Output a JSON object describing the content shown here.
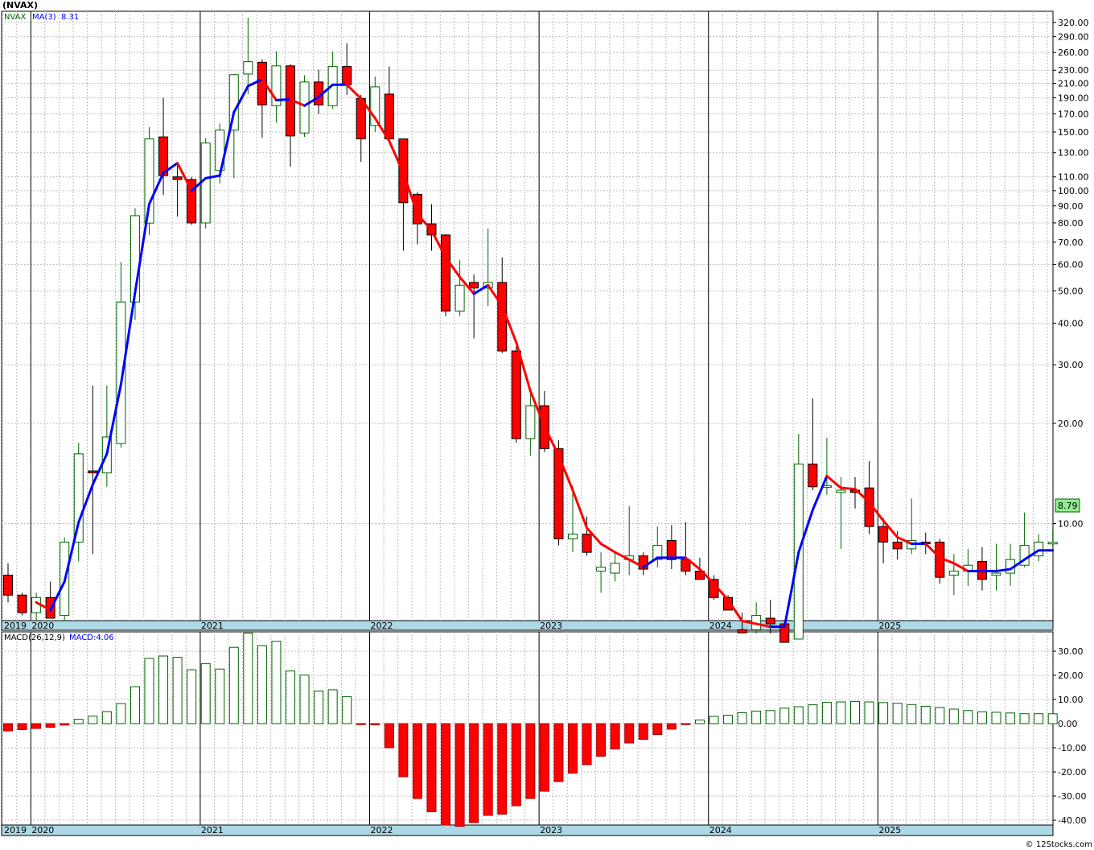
{
  "title": "(NVAX)",
  "legend": {
    "symbol": "NVAX",
    "ma_label": "MA(3)",
    "ma_value": "8.31"
  },
  "macd_legend": {
    "label": "MACD(26,12,9)",
    "value_label": "MACD:4.06"
  },
  "last_price_label": "8.79",
  "watermark": "© 12Stocks.com",
  "colors": {
    "up": "#ffffff",
    "up_stroke": "#006400",
    "down": "#ff0000",
    "down_stroke": "#000000",
    "ma_up": "#0000ff",
    "ma_down": "#ff0000",
    "grid": "#bdbdbd",
    "axis_bar": "#add8e6",
    "price_box": "#90ee90"
  },
  "chart_data": [
    {
      "type": "candlestick",
      "title": "(NVAX)",
      "scale": "log",
      "ylim": [
        5.2,
        340
      ],
      "y_ticks": [
        10,
        20,
        30,
        40,
        50,
        60,
        70,
        80,
        90,
        100,
        110,
        130,
        150,
        170,
        190,
        210,
        230,
        260,
        290,
        320
      ],
      "y_tick_labels": [
        "10.00",
        "20.00",
        "30.00",
        "40.00",
        "50.00",
        "60.00",
        "70.00",
        "80.00",
        "90.00",
        "100.00",
        "110.00",
        "130.00",
        "150.00",
        "170.00",
        "190.00",
        "210.00",
        "230.00",
        "260.00",
        "290.00",
        "320.00"
      ],
      "x_labels": [
        "2019",
        "2020",
        "2021",
        "2022",
        "2023",
        "2024",
        "2025"
      ],
      "x_label_months": [
        0,
        2,
        14,
        26,
        38,
        50,
        62
      ],
      "series_name": "NVAX",
      "start": "2019-11",
      "ohlc": [
        [
          7.0,
          7.6,
          5.8,
          6.1
        ],
        [
          6.1,
          6.2,
          5.3,
          5.4
        ],
        [
          5.4,
          6.2,
          5.1,
          6.0
        ],
        [
          6.0,
          6.7,
          5.2,
          5.2
        ],
        [
          5.3,
          9.1,
          5.1,
          8.8
        ],
        [
          8.8,
          17.5,
          7.7,
          16.2
        ],
        [
          14.4,
          26.0,
          8.1,
          14.2
        ],
        [
          14.2,
          26.0,
          12.9,
          18.2
        ],
        [
          17.4,
          61.0,
          16.9,
          46.3
        ],
        [
          46.3,
          88.6,
          40.9,
          84.1
        ],
        [
          79.9,
          155.0,
          73.5,
          143.0
        ],
        [
          145.0,
          190.0,
          97.0,
          111.0
        ],
        [
          110.0,
          121.0,
          83.6,
          108.0
        ],
        [
          108.0,
          110.0,
          79.0,
          80.0
        ],
        [
          80.0,
          144.0,
          77.0,
          139.0
        ],
        [
          115.0,
          159.0,
          105.0,
          152.0
        ],
        [
          152.0,
          224.0,
          109.0,
          223.0
        ],
        [
          224.0,
          331.0,
          195.0,
          244.0
        ],
        [
          243.0,
          248.0,
          144.0,
          181.0
        ],
        [
          180.0,
          262.0,
          160.0,
          237.0
        ],
        [
          237.0,
          240.0,
          118.0,
          146.0
        ],
        [
          149.0,
          222.0,
          145.0,
          212.0
        ],
        [
          212.0,
          231.0,
          170.0,
          181.0
        ],
        [
          180.0,
          262.0,
          176.0,
          236.0
        ],
        [
          236.0,
          277.0,
          194.0,
          208.0
        ],
        [
          189.0,
          194.0,
          122.0,
          143.0
        ],
        [
          157.0,
          220.0,
          150.0,
          205.0
        ],
        [
          195.0,
          236.0,
          139.0,
          143.0
        ],
        [
          143.0,
          143.0,
          66.0,
          92.0
        ],
        [
          97.5,
          99.0,
          69.0,
          79.5
        ],
        [
          79.5,
          91.0,
          66.0,
          73.6
        ],
        [
          73.6,
          74.0,
          42.0,
          43.5
        ],
        [
          43.5,
          62.0,
          42.0,
          52.0
        ],
        [
          53.0,
          56.0,
          36.0,
          51.0
        ],
        [
          51.0,
          77.0,
          45.0,
          53.0
        ],
        [
          53.0,
          63.0,
          32.5,
          33.0
        ],
        [
          33.0,
          34.0,
          17.5,
          18.0
        ],
        [
          18.0,
          24.5,
          16.0,
          22.6
        ],
        [
          22.6,
          25.0,
          16.4,
          16.8
        ],
        [
          16.8,
          17.8,
          8.6,
          9.0
        ],
        [
          9.0,
          13.0,
          8.2,
          9.3
        ],
        [
          9.3,
          10.5,
          8.0,
          8.2
        ],
        [
          7.2,
          8.2,
          6.2,
          7.4
        ],
        [
          7.1,
          8.2,
          6.7,
          7.6
        ],
        [
          7.8,
          11.3,
          7.0,
          8.0
        ],
        [
          8.0,
          8.2,
          7.0,
          7.3
        ],
        [
          7.8,
          9.8,
          7.4,
          8.6
        ],
        [
          8.9,
          9.9,
          7.3,
          7.8
        ],
        [
          7.8,
          10.1,
          7.0,
          7.2
        ],
        [
          7.2,
          7.9,
          6.9,
          6.8
        ],
        [
          6.8,
          7.0,
          5.9,
          6.0
        ],
        [
          6.0,
          6.1,
          5.5,
          5.5
        ],
        [
          4.8,
          5.4,
          4.3,
          4.7
        ],
        [
          4.8,
          5.8,
          4.3,
          5.3
        ],
        [
          5.2,
          5.9,
          4.5,
          5.0
        ],
        [
          5.0,
          5.1,
          4.2,
          4.4
        ],
        [
          4.5,
          18.6,
          4.4,
          15.1
        ],
        [
          15.1,
          23.8,
          12.6,
          12.9
        ],
        [
          12.9,
          18.1,
          12.2,
          13.0
        ],
        [
          12.4,
          13.8,
          8.4,
          12.6
        ],
        [
          12.6,
          13.8,
          11.1,
          12.4
        ],
        [
          12.8,
          15.4,
          9.3,
          9.8
        ],
        [
          9.8,
          10.4,
          7.6,
          8.8
        ],
        [
          8.8,
          9.5,
          7.8,
          8.4
        ],
        [
          8.4,
          11.9,
          8.1,
          8.9
        ],
        [
          8.8,
          9.4,
          8.1,
          8.7
        ],
        [
          8.8,
          9.0,
          6.6,
          6.9
        ],
        [
          7.0,
          8.1,
          6.1,
          7.2
        ],
        [
          7.2,
          8.4,
          6.5,
          7.5
        ],
        [
          7.7,
          8.5,
          6.3,
          6.8
        ],
        [
          7.0,
          8.7,
          6.3,
          7.1
        ],
        [
          7.1,
          8.7,
          6.5,
          7.8
        ],
        [
          7.5,
          10.8,
          7.4,
          8.6
        ],
        [
          8.0,
          9.3,
          7.7,
          8.8
        ],
        [
          8.79,
          9.6,
          8.6,
          8.79
        ]
      ],
      "ma3": [
        6.1,
        5.9,
        5.8,
        5.5,
        6.7,
        10.1,
        13.1,
        16.2,
        26.2,
        49.5,
        91.1,
        113.0,
        121.0,
        100.0,
        109.0,
        111.0,
        172.0,
        206.0,
        216.0,
        187.0,
        188.0,
        180.0,
        191.0,
        208.0,
        208.0,
        189.0,
        165.0,
        141.0,
        113.0,
        85.0,
        76.0,
        63.0,
        55.0,
        49.0,
        52.0,
        45.0,
        35.0,
        25.0,
        19.6,
        16.0,
        12.6,
        9.7,
        8.7,
        8.2,
        7.8,
        7.4,
        7.9,
        7.9,
        7.9,
        7.3,
        6.6,
        5.9,
        5.1,
        5.0,
        4.9,
        4.9,
        8.2,
        11.0,
        13.9,
        12.8,
        12.7,
        11.6,
        10.2,
        9.1,
        8.7,
        8.7,
        7.9,
        7.6,
        7.2,
        7.2,
        7.2,
        7.3,
        7.8,
        8.31,
        8.31
      ]
    },
    {
      "type": "bar",
      "title": "MACD(26,12,9)",
      "ylim": [
        -42,
        38
      ],
      "y_ticks": [
        -40,
        -30,
        -20,
        -10,
        0,
        10,
        20,
        30
      ],
      "y_tick_labels": [
        "-40.00",
        "-30.00",
        "-20.00",
        "-10.00",
        "0.00",
        "10.00",
        "20.00",
        "30.00"
      ],
      "x_labels": [
        "2019",
        "2020",
        "2021",
        "2022",
        "2023",
        "2024",
        "2025"
      ],
      "values": [
        -3.0,
        -2.5,
        -2.0,
        -1.5,
        -0.6,
        1.8,
        3.1,
        5.0,
        8.3,
        15.3,
        27.0,
        28.0,
        27.5,
        22.3,
        24.8,
        22.6,
        31.6,
        37.5,
        32.3,
        34.1,
        21.8,
        20.1,
        13.5,
        14.0,
        11.2,
        -0.4,
        -0.5,
        -10.0,
        -22.0,
        -31.0,
        -36.5,
        -42.0,
        -42.5,
        -41.0,
        -38.0,
        -37.5,
        -34.0,
        -31.0,
        -28.0,
        -24.0,
        -20.5,
        -17.0,
        -13.5,
        -10.5,
        -8.0,
        -6.5,
        -4.5,
        -2.3,
        -0.4,
        1.5,
        3.0,
        3.5,
        4.5,
        5.2,
        5.4,
        6.4,
        7.0,
        7.8,
        8.8,
        9.0,
        9.2,
        9.0,
        8.7,
        8.4,
        7.9,
        7.2,
        6.7,
        6.0,
        5.4,
        4.9,
        4.7,
        4.4,
        4.1,
        4.1,
        4.06
      ]
    }
  ]
}
